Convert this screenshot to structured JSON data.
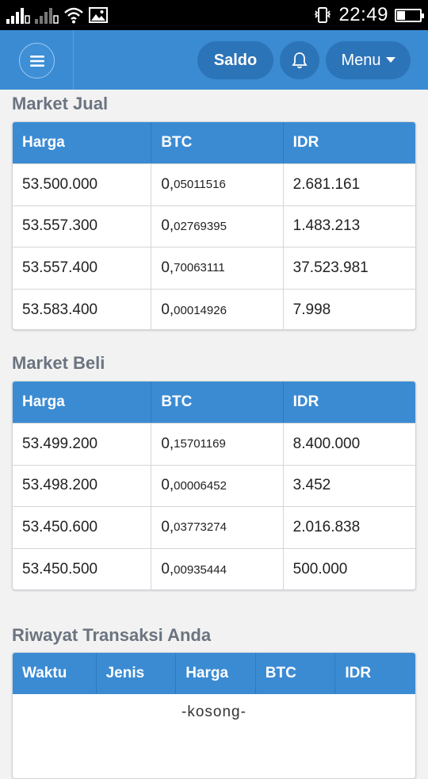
{
  "status_bar": {
    "time": "22:49",
    "icons": [
      "signal-icon",
      "signal-icon",
      "wifi-icon",
      "image-icon",
      "vibrate-icon",
      "battery-icon"
    ]
  },
  "appbar": {
    "saldo_label": "Saldo",
    "menu_label": "Menu",
    "accent": "#3b8bd3"
  },
  "market_jual": {
    "title": "Market Jual",
    "headers": [
      "Harga",
      "BTC",
      "IDR"
    ],
    "rows": [
      {
        "harga": "53.500.000",
        "btc_main": "0,",
        "btc_small": "05011516",
        "idr": "2.681.161"
      },
      {
        "harga": "53.557.300",
        "btc_main": "0,",
        "btc_small": "02769395",
        "idr": "1.483.213"
      },
      {
        "harga": "53.557.400",
        "btc_main": "0,",
        "btc_small": "70063111",
        "idr": "37.523.981"
      },
      {
        "harga": "53.583.400",
        "btc_main": "0,",
        "btc_small": "00014926",
        "idr": "7.998"
      }
    ]
  },
  "market_beli": {
    "title": "Market Beli",
    "headers": [
      "Harga",
      "BTC",
      "IDR"
    ],
    "rows": [
      {
        "harga": "53.499.200",
        "btc_main": "0,",
        "btc_small": "15701169",
        "idr": "8.400.000"
      },
      {
        "harga": "53.498.200",
        "btc_main": "0,",
        "btc_small": "00006452",
        "idr": "3.452"
      },
      {
        "harga": "53.450.600",
        "btc_main": "0,",
        "btc_small": "03773274",
        "idr": "2.016.838"
      },
      {
        "harga": "53.450.500",
        "btc_main": "0,",
        "btc_small": "00935444",
        "idr": "500.000"
      }
    ]
  },
  "riwayat": {
    "title": "Riwayat Transaksi Anda",
    "headers": [
      "Waktu",
      "Jenis",
      "Harga",
      "BTC",
      "IDR"
    ],
    "empty_text": "-kosong-"
  }
}
